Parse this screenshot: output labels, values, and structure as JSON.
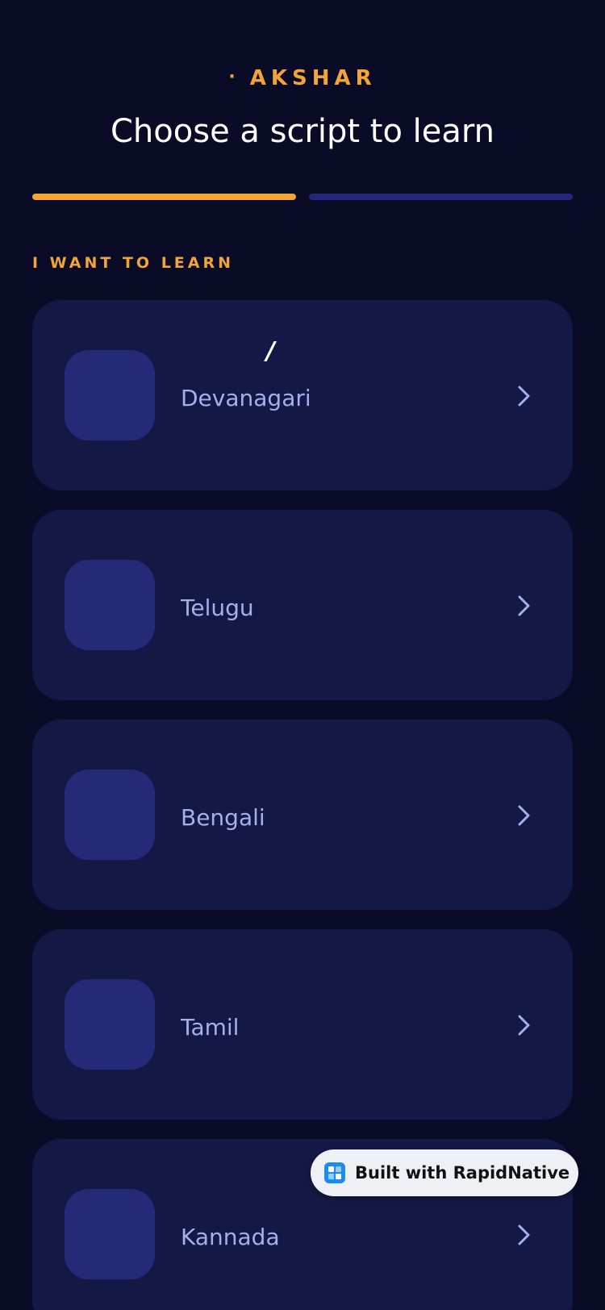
{
  "header": {
    "brand_dot": "·",
    "brand": "AKSHAR",
    "title": "Choose a script to learn"
  },
  "progress": {
    "current_step": 1,
    "total_steps": 2
  },
  "section": {
    "label": "I WANT TO LEARN"
  },
  "scripts": [
    {
      "name": "Devanagari",
      "glyph": "/"
    },
    {
      "name": "Telugu",
      "glyph": ""
    },
    {
      "name": "Bengali",
      "glyph": ""
    },
    {
      "name": "Tamil",
      "glyph": ""
    },
    {
      "name": "Kannada",
      "glyph": ""
    }
  ],
  "badge": {
    "text": "Built with RapidNative"
  },
  "colors": {
    "background": "#0a0b26",
    "accent": "#f2a534",
    "card": "#131845",
    "glyph_box": "#242a78",
    "progress_inactive": "#25287a",
    "label_text": "#a3b0ec"
  },
  "icons": {
    "row_action": "chevron-right-icon",
    "badge_logo": "rapidnative-logo-icon"
  }
}
